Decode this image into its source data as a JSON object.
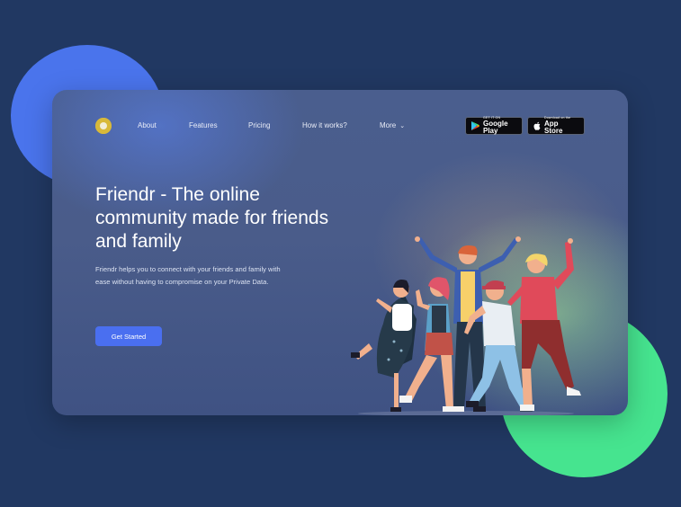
{
  "nav": {
    "items": [
      {
        "label": "About"
      },
      {
        "label": "Features"
      },
      {
        "label": "Pricing"
      },
      {
        "label": "How it works?"
      },
      {
        "label": "More"
      }
    ]
  },
  "store": {
    "google": {
      "small": "GET IT ON",
      "big": "Google Play"
    },
    "apple": {
      "small": "Download on the",
      "big": "App Store"
    }
  },
  "hero": {
    "headline": "Friendr - The online community made for friends and family",
    "description": "Friendr helps you to connect with your friends and family with ease without having to compromise on your Private Data.",
    "cta_label": "Get Started"
  },
  "colors": {
    "background": "#213862",
    "blob_blue": "#4a74ec",
    "blob_green": "#46e48f",
    "accent": "#4a6ff0",
    "logo": "#d8b93a"
  },
  "icons": [
    "logo-icon",
    "chevron-down-icon",
    "google-play-icon",
    "apple-icon"
  ]
}
